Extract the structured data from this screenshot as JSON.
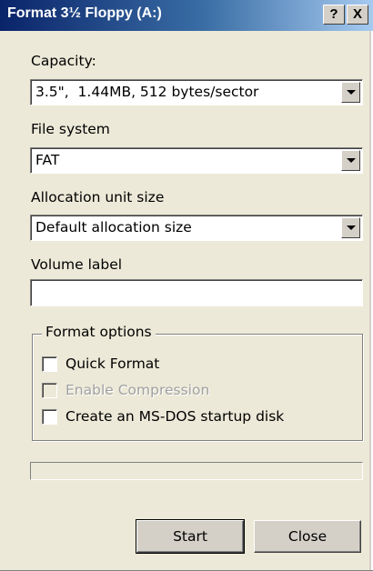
{
  "window": {
    "title": "Format 3½ Floppy (A:)",
    "help_button": "?",
    "close_button": "X"
  },
  "capacity": {
    "label": "Capacity:",
    "value": "3.5\",  1.44MB, 512 bytes/sector"
  },
  "file_system": {
    "label": "File system",
    "value": "FAT"
  },
  "allocation": {
    "label": "Allocation unit size",
    "value": "Default allocation size"
  },
  "volume_label": {
    "label": "Volume label",
    "value": ""
  },
  "format_options": {
    "title": "Format options",
    "quick_format": {
      "label": "Quick Format",
      "checked": false,
      "enabled": true
    },
    "enable_compression": {
      "label": "Enable Compression",
      "checked": false,
      "enabled": false
    },
    "startup_disk": {
      "label": "Create an MS-DOS startup disk",
      "checked": false,
      "enabled": true
    }
  },
  "progress": {
    "value": 0
  },
  "buttons": {
    "start": "Start",
    "close": "Close"
  },
  "colors": {
    "dialog_bg": "#ece9d8",
    "title_bar": "#0a246a",
    "disabled_text": "#a0a0a0"
  }
}
